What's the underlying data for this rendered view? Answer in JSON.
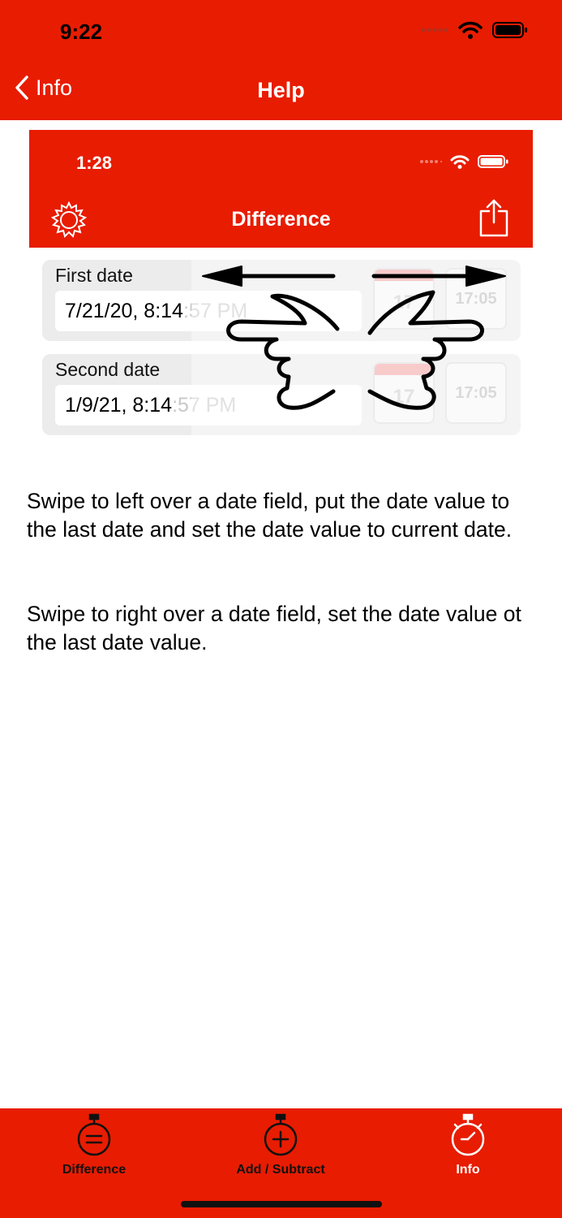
{
  "status_bar": {
    "time": "9:22"
  },
  "nav": {
    "back_label": "Info",
    "title": "Help"
  },
  "illustration": {
    "time": "1:28",
    "title": "Difference",
    "first_label": "First date",
    "first_value": "7/21/20, 8:14",
    "first_value_dim": ":57 PM",
    "second_label": "Second date",
    "second_value": "1/9/21, 8:14",
    "second_value_dim": ":57 PM",
    "calendar_number": "17",
    "clock_time": "17:05"
  },
  "help": {
    "paragraph_1": "Swipe to left over a date field, put the date value to the last date and set the date value to current date.",
    "paragraph_2": "Swipe to right over a date field, set the date value ot the last date value."
  },
  "tabs": [
    {
      "label": "Difference",
      "icon": "stopwatch-equals-icon"
    },
    {
      "label": "Add / Subtract",
      "icon": "stopwatch-plus-icon"
    },
    {
      "label": "Info",
      "icon": "stopwatch-icon"
    }
  ],
  "colors": {
    "accent": "#e81c00",
    "active_tab": "#ffffff",
    "inactive_tab": "#111111"
  }
}
